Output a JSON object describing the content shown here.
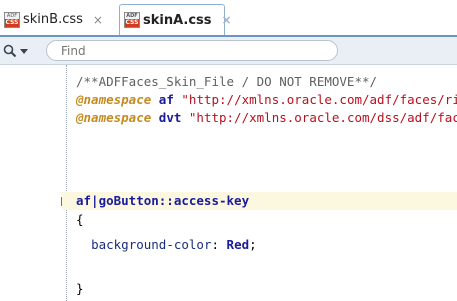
{
  "tabs": [
    {
      "label": "skinB.css",
      "close": "×",
      "icon_top": "ADF",
      "icon_bottom": "CSS",
      "active": false
    },
    {
      "label": "skinA.css",
      "close": "×",
      "icon_top": "ADF",
      "icon_bottom": "CSS",
      "active": true
    }
  ],
  "find": {
    "placeholder": "Find",
    "search_icon": "search-icon",
    "dropdown_icon": "chevron-down-icon"
  },
  "code": {
    "line1": "/**ADFFaces_Skin_File / DO NOT REMOVE**/",
    "line2": {
      "keyword": "@namespace",
      "prefix": "af",
      "string": "\"http://xmlns.oracle.com/adf/faces/rich\";"
    },
    "line3": {
      "keyword": "@namespace",
      "prefix": "dvt",
      "string": "\"http://xmlns.oracle.com/dss/adf/faces\";"
    },
    "selector": "af|goButton::access-key",
    "open_brace": "{",
    "property": "background-color",
    "colon": ":",
    "value": "Red",
    "semicolon": ";",
    "close_brace": "}",
    "fold_symbol": "−"
  },
  "colors": {
    "tab_border": "#6b96c4",
    "findbar_bg": "#eaeff5",
    "namespace_keyword": "#c38b22",
    "string": "#b8101e",
    "selector": "#1a1a9c",
    "current_line": "#fcf8e0"
  }
}
